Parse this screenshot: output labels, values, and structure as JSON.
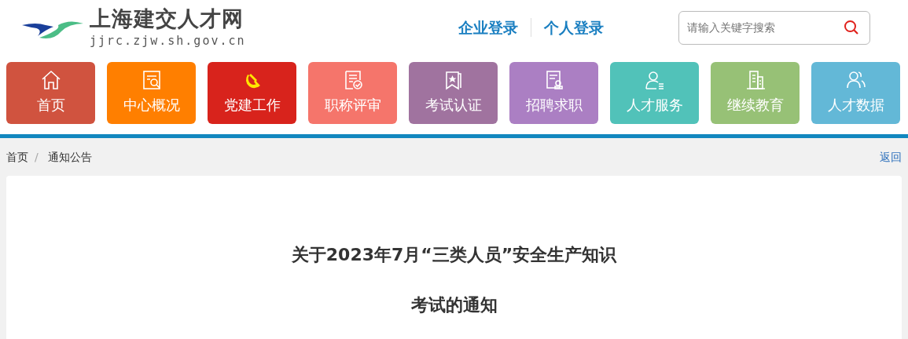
{
  "site": {
    "name": "上海建交人才网",
    "url": "jjrc.zjw.sh.gov.cn"
  },
  "login_links": [
    "企业登录",
    "个人登录"
  ],
  "search": {
    "placeholder": "请输入关键字搜索"
  },
  "nav": [
    {
      "label": "首页",
      "kind": "home",
      "color": "#d0533f"
    },
    {
      "label": "中心概况",
      "kind": "overview",
      "color": "#ff7f00"
    },
    {
      "label": "党建工作",
      "kind": "party",
      "color": "#d8231c"
    },
    {
      "label": "职称评审",
      "kind": "review",
      "color": "#f5756b"
    },
    {
      "label": "考试认证",
      "kind": "exam",
      "color": "#a0739f"
    },
    {
      "label": "招聘求职",
      "kind": "jobs",
      "color": "#ab7fc3"
    },
    {
      "label": "人才服务",
      "kind": "service",
      "color": "#51c2b9"
    },
    {
      "label": "继续教育",
      "kind": "education",
      "color": "#97c176"
    },
    {
      "label": "人才数据",
      "kind": "data",
      "color": "#63b8d7"
    }
  ],
  "breadcrumb": [
    "首页",
    "通知公告"
  ],
  "breadcrumb_separator": "/",
  "back_link": "返回",
  "article": {
    "title_lines": [
      "关于2023年7月“三类人员”安全生产知识",
      "考试的通知"
    ]
  }
}
